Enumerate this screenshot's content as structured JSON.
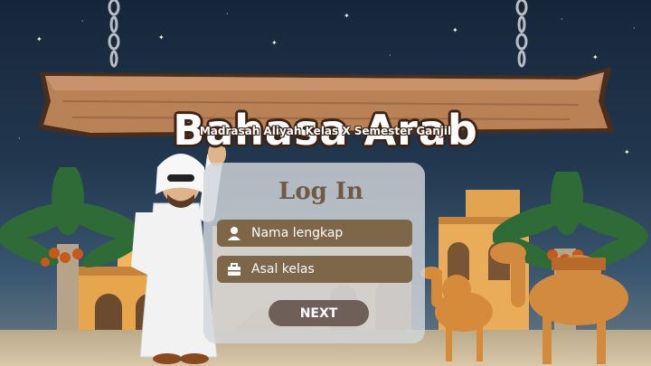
{
  "header": {
    "title": "Bahasa Arab",
    "subtitle": "Madrasah Aliyah Kelas X Semester Ganjil"
  },
  "login": {
    "title": "Log In",
    "name_placeholder": "Nama lengkap",
    "class_placeholder": "Asal kelas",
    "next_label": "NEXT"
  },
  "colors": {
    "field_bg": "#7e6649",
    "button_bg": "#6e5f58",
    "title_color": "#6e5a45"
  },
  "icons": [
    "user-icon",
    "briefcase-icon"
  ]
}
